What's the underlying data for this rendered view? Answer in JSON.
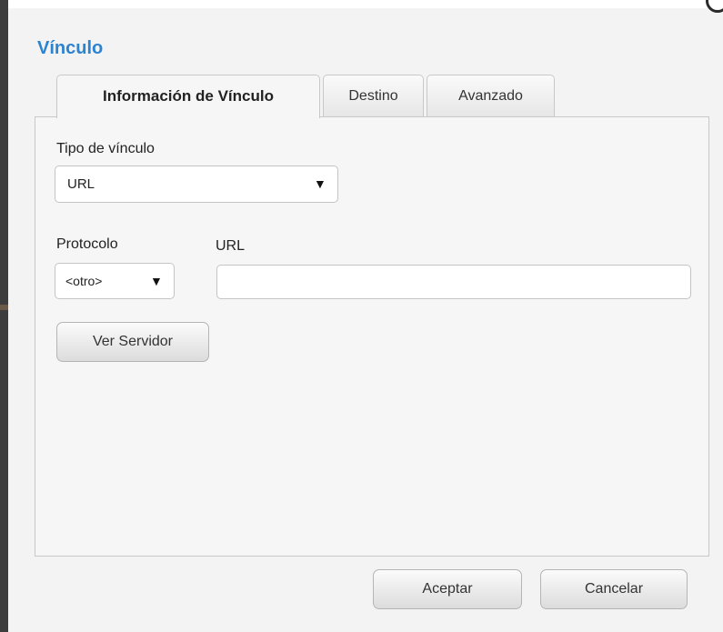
{
  "dialog": {
    "title": "Vínculo",
    "tabs": [
      {
        "label": "Información de Vínculo",
        "active": true
      },
      {
        "label": "Destino",
        "active": false
      },
      {
        "label": "Avanzado",
        "active": false
      }
    ]
  },
  "link_info": {
    "link_type_label": "Tipo de vínculo",
    "link_type_value": "URL",
    "protocol_label": "Protocolo",
    "protocol_value": "<otro>",
    "url_label": "URL",
    "url_value": "",
    "browse_server_label": "Ver Servidor"
  },
  "footer": {
    "ok_label": "Aceptar",
    "cancel_label": "Cancelar"
  },
  "icons": {
    "dropdown_arrow": "▼",
    "close": "close-icon"
  },
  "colors": {
    "title": "#2c83d0",
    "dialog_bg": "#f3f3f3",
    "border": "#c8c8c8"
  }
}
